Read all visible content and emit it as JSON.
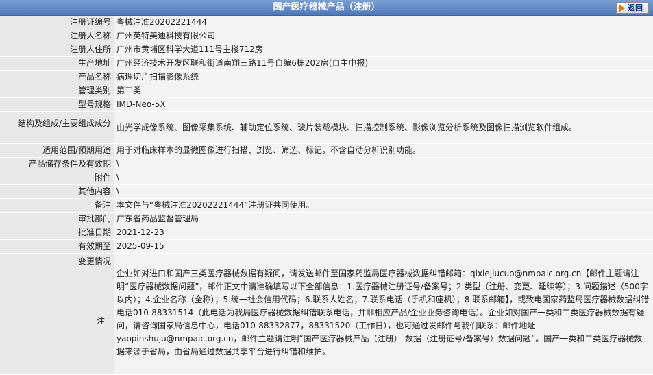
{
  "header": {
    "title": "国产医疗器械产品（注册）",
    "back_label": "返回"
  },
  "rows": [
    {
      "label": "注册证编号",
      "value": "粤械注准20202221444"
    },
    {
      "label": "注册人名称",
      "value": "广州英特美迪科技有限公司"
    },
    {
      "label": "注册人住所",
      "value": "广州市黄埔区科学大道111号主楼712房"
    },
    {
      "label": "生产地址",
      "value": "广州经济技术开发区联和街道南翔三路11号自编6栋202房(自主申报)"
    },
    {
      "label": "产品名称",
      "value": "病理切片扫描影像系统"
    },
    {
      "label": "管理类别",
      "value": "第二类"
    },
    {
      "label": "型号规格",
      "value": "IMD-Neo-5X"
    },
    {
      "label": "结构及组成/主要组成成分",
      "value": "由光学成像系统、图像采集系统、辅助定位系统、玻片装载模块、扫描控制系统、影像浏览分析系统及图像扫描浏览软件组成。"
    },
    {
      "label": "适用范围/预期用途",
      "value": "用于对临床样本的显微图像进行扫描、浏览、筛选、标记，不含自动分析识别功能。"
    },
    {
      "label": "产品储存条件及有效期",
      "value": "\\"
    },
    {
      "label": "附件",
      "value": "\\"
    },
    {
      "label": "其他内容",
      "value": "\\"
    },
    {
      "label": "备注",
      "value": "本文件与“粤械注准20202221444”注册证共同使用。"
    },
    {
      "label": "审批部门",
      "value": "广东省药品监督管理局"
    },
    {
      "label": "批准日期",
      "value": "2021-12-23"
    },
    {
      "label": "有效期至",
      "value": "2025-09-15"
    }
  ],
  "change_label": "变更情况",
  "notes_label": "注",
  "notes_text": "企业如对进口和国产三类医疗器械数据有疑问，请发送邮件至国家药监局医疗器械数据纠错邮箱：qixiejiucuo@nmpaic.org.cn【邮件主题请注明“医疗器械数据问题”，邮件正文中请准确填写以下全部信息：1.医疗器械注册证号/备案号；2.类型（注册、变更、延续等）；3.问题描述（500字以内）；4.企业名称（全称）；5.统一社会信用代码；6.联系人姓名；7.联系电话（手机和座机）；8.联系邮箱】，或致电国家药监局医疗器械数据纠错电话010-88331514（此电话为我局医疗器械数据纠错联系电话，并非相应产品/企业业务咨询电话）。企业如对国产一类和二类医疗器械数据有疑问，请咨询国家局信息中心，电话010-88332877，88331520（工作日），也可通过发邮件与我们联系：邮件地址yaopinshuju@nmpaic.org.cn，邮件主题请注明“国产医疗器械产品（注册）-数据（注册证号/备案号）数据问题”。国产一类和二类医疗器械数据来源于省局，由省局通过数据共享平台进行纠错和维护。"
}
